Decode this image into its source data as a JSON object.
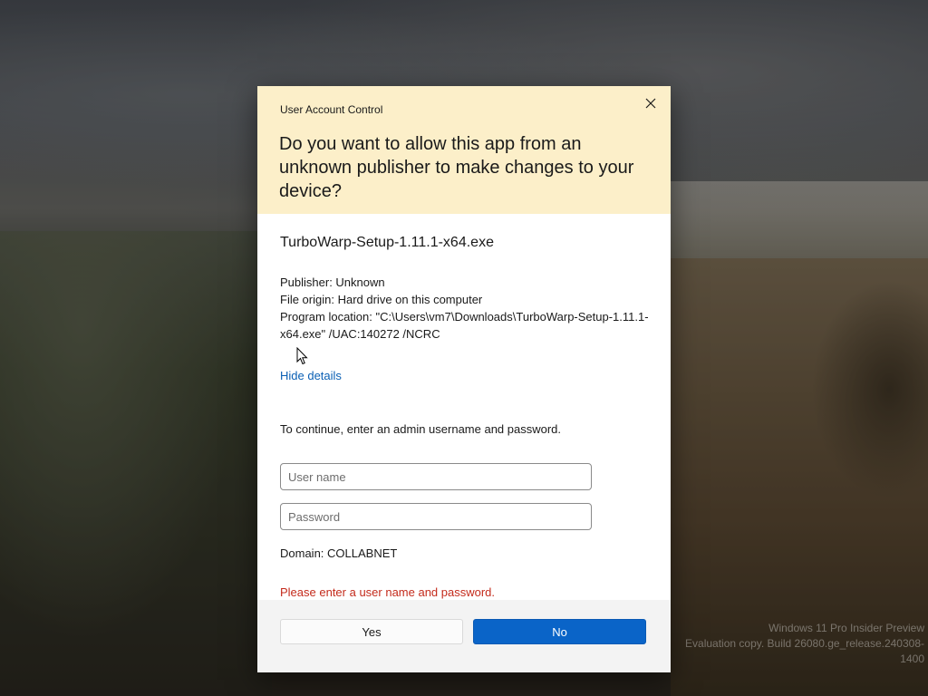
{
  "desktop": {
    "watermark_line1": "Windows 11 Pro Insider Preview",
    "watermark_line2": "Evaluation copy. Build 26080.ge_release.240308-1400"
  },
  "dialog": {
    "title": "User Account Control",
    "close_icon": "close-icon",
    "question": "Do you want to allow this app from an unknown publisher to make changes to your device?",
    "app_name": "TurboWarp-Setup-1.11.1-x64.exe",
    "publisher": "Publisher: Unknown",
    "file_origin": "File origin: Hard drive on this computer",
    "program_location": "Program location: \"C:\\Users\\vm7\\Downloads\\TurboWarp-Setup-1.11.1-x64.exe\" /UAC:140272 /NCRC",
    "hide_details": "Hide details",
    "continue_text": "To continue, enter an admin username and password.",
    "username": {
      "value": "",
      "placeholder": "User name"
    },
    "password": {
      "value": "",
      "placeholder": "Password"
    },
    "domain": "Domain: COLLABNET",
    "error": "Please enter a user name and password.",
    "yes_label": "Yes",
    "no_label": "No"
  },
  "colors": {
    "header_bg": "#fcefc9",
    "accent": "#0a64c8",
    "link": "#0a5fb4",
    "error": "#c42b1c"
  }
}
